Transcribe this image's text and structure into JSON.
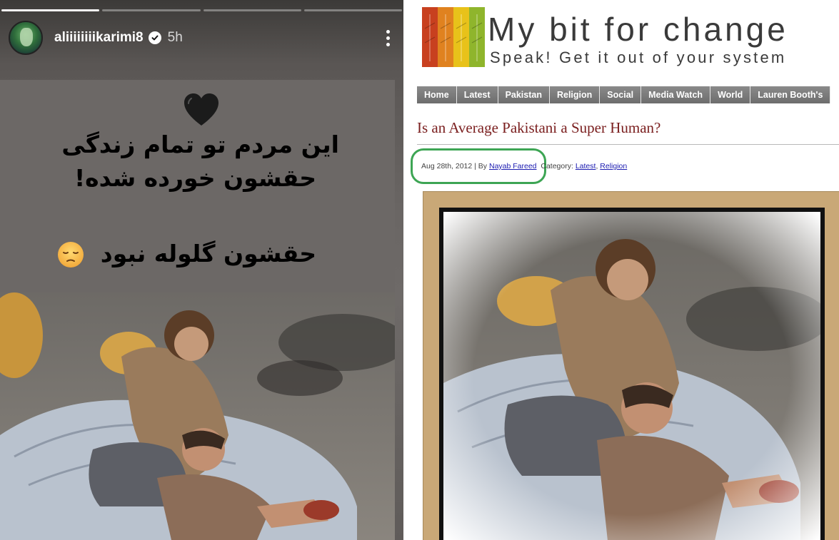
{
  "story": {
    "progress_segments": [
      true,
      false,
      false,
      false
    ],
    "username": "aliiiiiiiikarimi8",
    "time_ago": "5h",
    "icons": {
      "avatar": "profile-avatar",
      "verified": "verified-badge-icon",
      "more": "more-vertical-icon",
      "heart": "black-heart-emoji",
      "sad": "pensive-face-emoji"
    },
    "text_line_1": "این مردم تو تمام زندگی",
    "text_line_2": "حقشون خورده شده!",
    "text_line_3": "حقشون گلوله نبود",
    "photo": "two-children-sitting-by-sacks-photo"
  },
  "blog": {
    "site_title": "My bit for change",
    "site_tagline": "Speak! Get it out of your system",
    "nav": [
      "Home",
      "Latest",
      "Pakistan",
      "Religion",
      "Social",
      "Media Watch",
      "World",
      "Lauren Booth's"
    ],
    "post_title": "Is an Average Pakistani a Super Human?",
    "meta": {
      "date": "Aug 28th, 2012",
      "by": "| By",
      "author": "Nayab Fareed",
      "category_label": "Category:",
      "categories": [
        "Latest",
        "Religion"
      ],
      "separator": ","
    },
    "highlight_color": "#3da554",
    "title_color": "#7a1e1e",
    "frame_color": "#c9a877",
    "photo": "two-children-sitting-by-sacks-photo"
  }
}
